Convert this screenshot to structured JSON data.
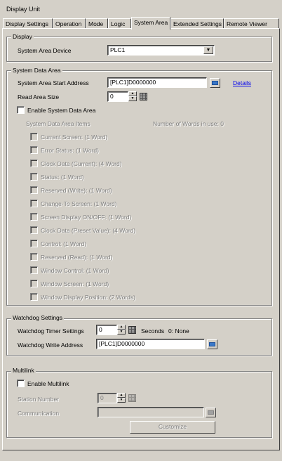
{
  "window": {
    "title": "Display Unit"
  },
  "tabs": [
    "Display Settings",
    "Operation",
    "Mode",
    "Logic",
    "System Area",
    "Extended Settings",
    "Remote Viewer"
  ],
  "display_group": {
    "label": "Display",
    "device_label": "System Area Device",
    "device_value": "PLC1"
  },
  "system_data_area": {
    "label": "System Data Area",
    "start_address_label": "System Area Start Address",
    "start_address_value": "[PLC1]D0000000",
    "details_link": "Details",
    "read_size_label": "Read Area Size",
    "read_size_value": "0",
    "enable_label": "Enable System Data Area",
    "items_header": "System Data Area Items",
    "words_in_use": "Number of Words in use: 0",
    "items": [
      "Current Screen: (1 Word)",
      "Error Status: (1 Word)",
      "Clock Data (Current): (4 Word)",
      "Status: (1 Word)",
      "Reserved (Write): (1 Word)",
      "Change-To Screen: (1 Word)",
      "Screen Display ON/OFF: (1 Word)",
      "Clock Data (Preset Value): (4 Word)",
      "Control: (1 Word)",
      "Reserved (Read): (1 Word)",
      "Window Control: (1 Word)",
      "Window Screen: (1 Word)",
      "Window Display Position: (2 Words)"
    ]
  },
  "watchdog": {
    "label": "Watchdog Settings",
    "timer_label": "Watchdog Timer Settings",
    "timer_value": "0",
    "seconds_label": "Seconds",
    "none_label": "0: None",
    "write_address_label": "Watchdog Write Address",
    "write_address_value": "[PLC1]D0000000"
  },
  "multilink": {
    "label": "Multilink",
    "enable_label": "Enable Multilink",
    "station_label": "Station Number",
    "station_value": "0",
    "communication_label": "Communication",
    "communication_value": "",
    "customize_label": "Customize"
  }
}
